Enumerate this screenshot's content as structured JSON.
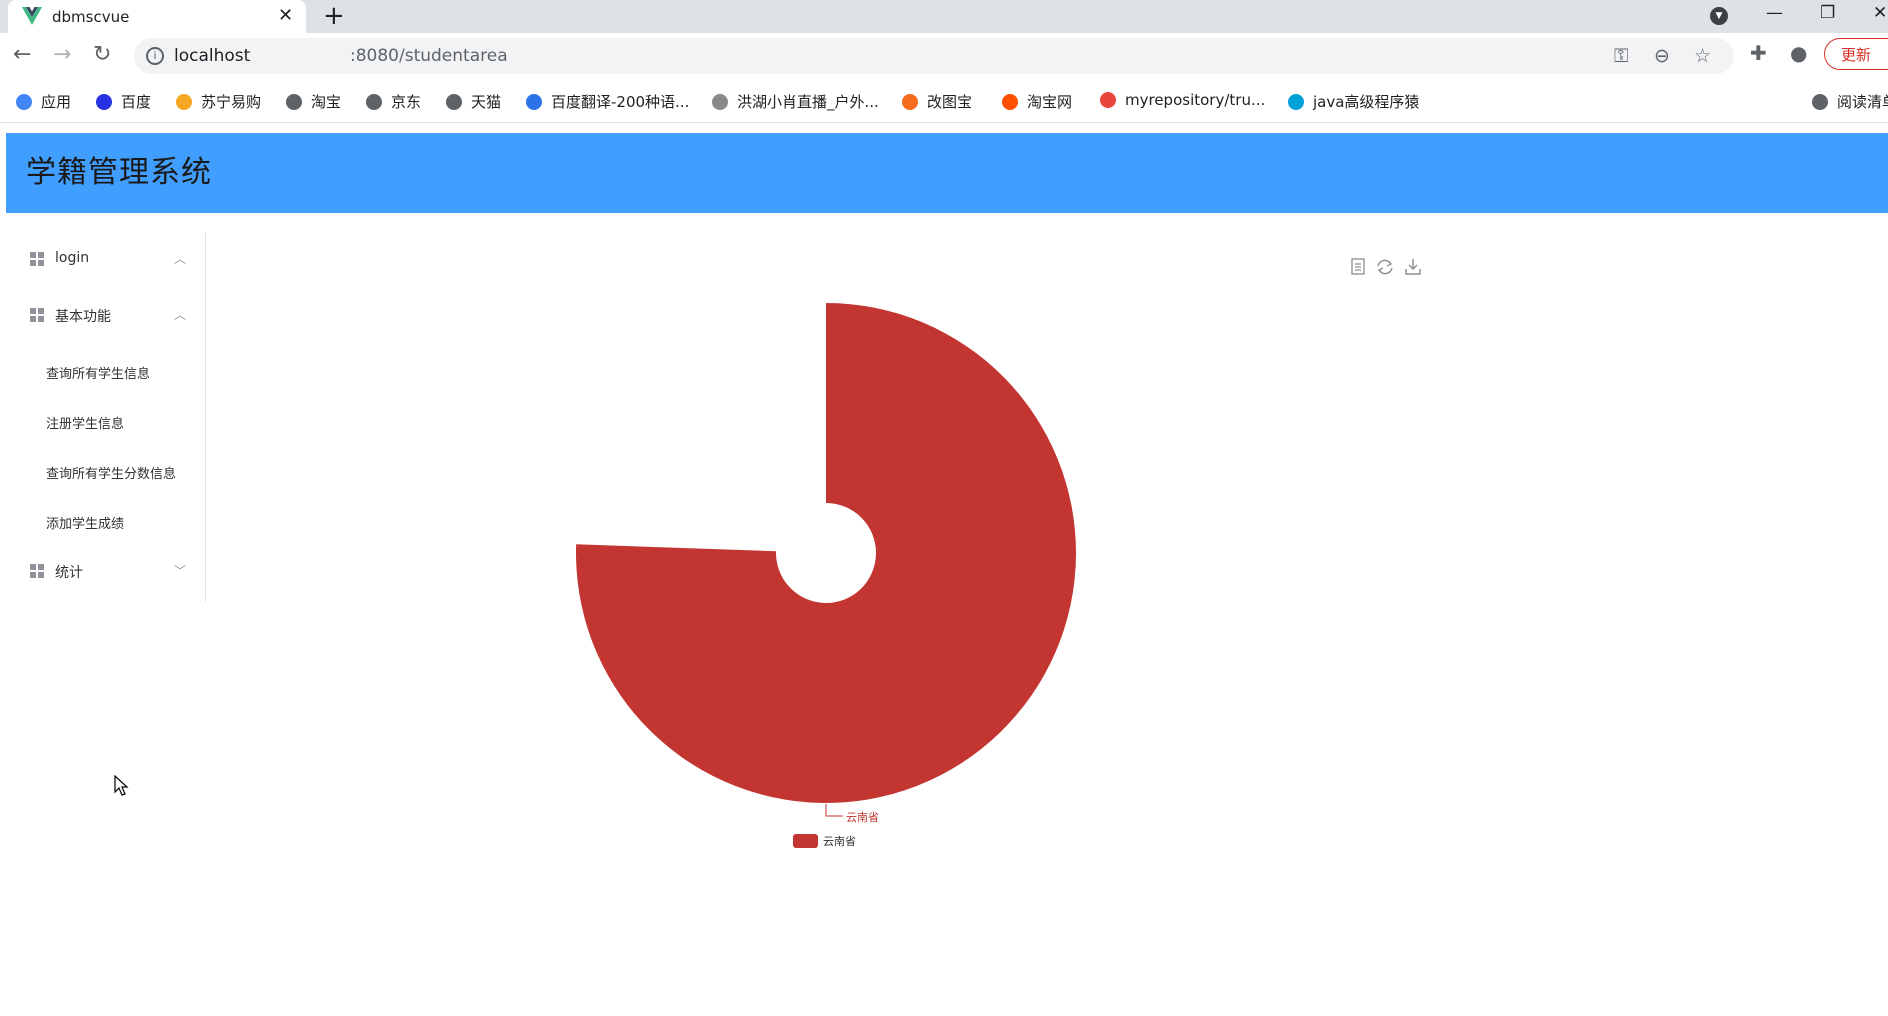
{
  "browser": {
    "tab_title": "dbmscvue",
    "url_host": "localhost",
    "url_path": ":8080/studentarea",
    "update_label": "更新"
  },
  "bookmarks": [
    {
      "label": "应用",
      "color": "#4285f4"
    },
    {
      "label": "百度",
      "color": "#2932e1"
    },
    {
      "label": "苏宁易购",
      "color": "#f5a623"
    },
    {
      "label": "淘宝",
      "color": "#5f6368"
    },
    {
      "label": "京东",
      "color": "#5f6368"
    },
    {
      "label": "天猫",
      "color": "#5f6368"
    },
    {
      "label": "百度翻译-200种语...",
      "color": "#2b74e8"
    },
    {
      "label": "洪湖小肖直播_户外...",
      "color": "#8a8a8a"
    },
    {
      "label": "改图宝",
      "color": "#f76b1c"
    },
    {
      "label": "淘宝网",
      "color": "#ff5000"
    },
    {
      "label": "myrepository/tru...",
      "color": "#e8453c"
    },
    {
      "label": "java高级程序猿",
      "color": "#00a1d6"
    },
    {
      "label": "阅读清单",
      "color": "#5f6368"
    }
  ],
  "app": {
    "title": "学籍管理系统",
    "header_color": "#409eff"
  },
  "sidebar": {
    "groups": [
      {
        "label": "login",
        "arrow": "^"
      },
      {
        "label": "基本功能",
        "arrow": "^"
      },
      {
        "label": "统计",
        "arrow": "v"
      }
    ],
    "items": [
      {
        "label": "查询所有学生信息"
      },
      {
        "label": "注册学生信息"
      },
      {
        "label": "查询所有学生分数信息"
      },
      {
        "label": "添加学生成绩"
      }
    ]
  },
  "chart_data": {
    "type": "pie",
    "variant": "rose",
    "slices": [
      {
        "name": "云南省",
        "value": 1,
        "color": "#c23531"
      }
    ],
    "legend": [
      "云南省"
    ],
    "legend_placement": "bottom",
    "toolbox": [
      "data-view",
      "restore",
      "save-as-image"
    ]
  }
}
